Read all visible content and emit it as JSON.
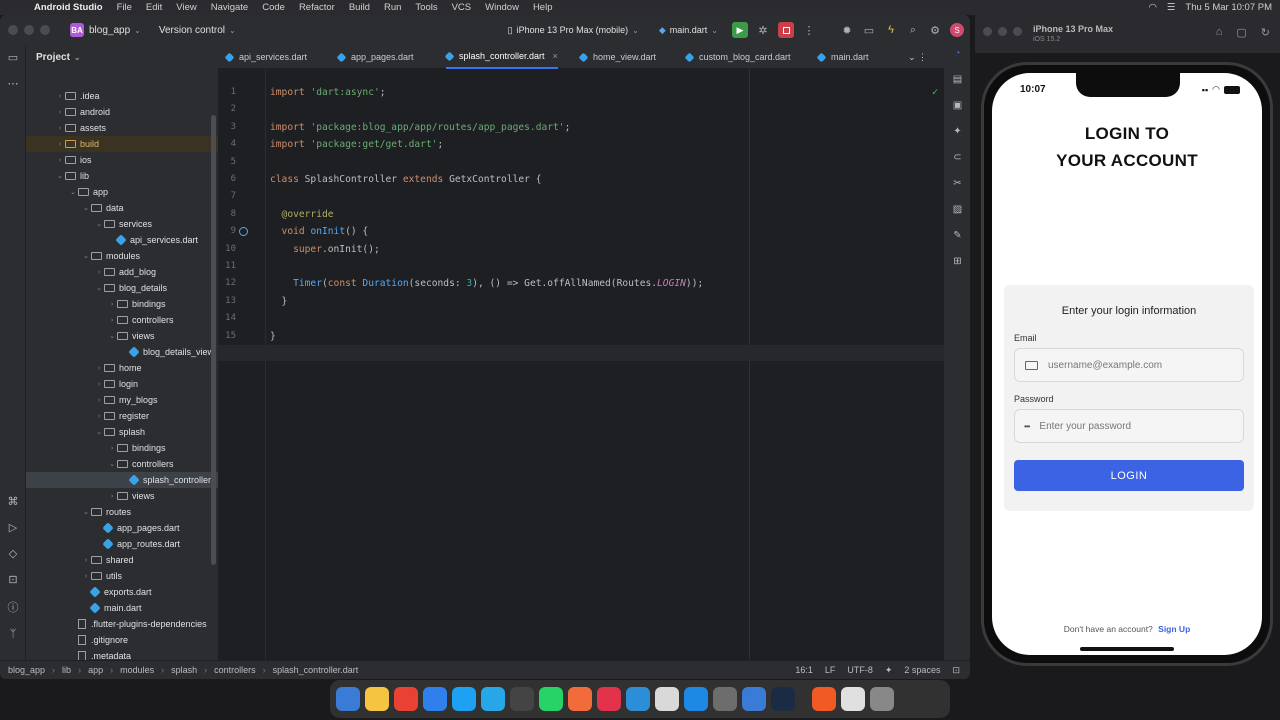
{
  "menubar": {
    "app_name": "Android Studio",
    "items": [
      "File",
      "Edit",
      "View",
      "Navigate",
      "Code",
      "Refactor",
      "Build",
      "Run",
      "Tools",
      "VCS",
      "Window",
      "Help"
    ],
    "datetime": "Thu 5 Mar  10:07 PM"
  },
  "titlebar": {
    "project_badge": "BA",
    "project_name": "blog_app",
    "vcs": "Version control",
    "device": "iPhone 13 Pro Max (mobile)",
    "run_config": "main.dart",
    "user_initial": "S"
  },
  "project_panel": {
    "title": "Project",
    "rows": [
      {
        "label": ".idea",
        "indent": 1,
        "kind": "folder",
        "chev": "›"
      },
      {
        "label": "android",
        "indent": 1,
        "kind": "folder",
        "chev": "›"
      },
      {
        "label": "assets",
        "indent": 1,
        "kind": "folder",
        "chev": "›"
      },
      {
        "label": "build",
        "indent": 1,
        "kind": "folder-orange",
        "chev": "›"
      },
      {
        "label": "ios",
        "indent": 1,
        "kind": "folder",
        "chev": "›"
      },
      {
        "label": "lib",
        "indent": 1,
        "kind": "folder",
        "chev": "⌄"
      },
      {
        "label": "app",
        "indent": 2,
        "kind": "folder",
        "chev": "⌄"
      },
      {
        "label": "data",
        "indent": 3,
        "kind": "folder",
        "chev": "⌄"
      },
      {
        "label": "services",
        "indent": 4,
        "kind": "folder",
        "chev": "⌄"
      },
      {
        "label": "api_services.dart",
        "indent": 5,
        "kind": "dart",
        "chev": ""
      },
      {
        "label": "modules",
        "indent": 3,
        "kind": "folder",
        "chev": "⌄"
      },
      {
        "label": "add_blog",
        "indent": 4,
        "kind": "folder",
        "chev": "›"
      },
      {
        "label": "blog_details",
        "indent": 4,
        "kind": "folder",
        "chev": "⌄"
      },
      {
        "label": "bindings",
        "indent": 5,
        "kind": "folder",
        "chev": "›"
      },
      {
        "label": "controllers",
        "indent": 5,
        "kind": "folder",
        "chev": "›"
      },
      {
        "label": "views",
        "indent": 5,
        "kind": "folder",
        "chev": "⌄"
      },
      {
        "label": "blog_details_view",
        "indent": 6,
        "kind": "dart",
        "chev": ""
      },
      {
        "label": "home",
        "indent": 4,
        "kind": "folder",
        "chev": "›"
      },
      {
        "label": "login",
        "indent": 4,
        "kind": "folder",
        "chev": "›"
      },
      {
        "label": "my_blogs",
        "indent": 4,
        "kind": "folder",
        "chev": "›"
      },
      {
        "label": "register",
        "indent": 4,
        "kind": "folder",
        "chev": "›"
      },
      {
        "label": "splash",
        "indent": 4,
        "kind": "folder",
        "chev": "⌄"
      },
      {
        "label": "bindings",
        "indent": 5,
        "kind": "folder",
        "chev": "›"
      },
      {
        "label": "controllers",
        "indent": 5,
        "kind": "folder",
        "chev": "⌄"
      },
      {
        "label": "splash_controller",
        "indent": 6,
        "kind": "dart",
        "chev": "",
        "selected": true
      },
      {
        "label": "views",
        "indent": 5,
        "kind": "folder",
        "chev": "›"
      },
      {
        "label": "routes",
        "indent": 3,
        "kind": "folder",
        "chev": "⌄"
      },
      {
        "label": "app_pages.dart",
        "indent": 4,
        "kind": "dart",
        "chev": ""
      },
      {
        "label": "app_routes.dart",
        "indent": 4,
        "kind": "dart",
        "chev": ""
      },
      {
        "label": "shared",
        "indent": 3,
        "kind": "folder",
        "chev": "›"
      },
      {
        "label": "utils",
        "indent": 3,
        "kind": "folder",
        "chev": "›"
      },
      {
        "label": "exports.dart",
        "indent": 3,
        "kind": "dart",
        "chev": ""
      },
      {
        "label": "main.dart",
        "indent": 3,
        "kind": "dart",
        "chev": ""
      },
      {
        "label": ".flutter-plugins-dependencies",
        "indent": 2,
        "kind": "plain",
        "chev": ""
      },
      {
        "label": ".gitignore",
        "indent": 2,
        "kind": "plain",
        "chev": ""
      },
      {
        "label": ".metadata",
        "indent": 2,
        "kind": "plain",
        "chev": ""
      }
    ]
  },
  "tabs": [
    {
      "label": "api_services.dart"
    },
    {
      "label": "app_pages.dart"
    },
    {
      "label": "splash_controller.dart",
      "active": true
    },
    {
      "label": "home_view.dart"
    },
    {
      "label": "custom_blog_card.dart"
    },
    {
      "label": "main.dart"
    }
  ],
  "code_lines": [
    [
      [
        "kw",
        "import "
      ],
      [
        "str",
        "'dart:async'"
      ],
      [
        "cls",
        ";"
      ]
    ],
    [],
    [
      [
        "kw",
        "import "
      ],
      [
        "str",
        "'package:blog_app/app/routes/app_pages.dart'"
      ],
      [
        "cls",
        ";"
      ]
    ],
    [
      [
        "kw",
        "import "
      ],
      [
        "str",
        "'package:get/get.dart'"
      ],
      [
        "cls",
        ";"
      ]
    ],
    [],
    [
      [
        "kw",
        "class "
      ],
      [
        "cls",
        "SplashController "
      ],
      [
        "kw",
        "extends "
      ],
      [
        "cls",
        "GetxController {"
      ]
    ],
    [],
    [
      [
        "ann",
        "  @override"
      ]
    ],
    [
      [
        "kw",
        "  void "
      ],
      [
        "fn",
        "onInit"
      ],
      [
        "cls",
        "() {"
      ]
    ],
    [
      [
        "kw",
        "    super"
      ],
      [
        "cls",
        ".onInit();"
      ]
    ],
    [],
    [
      [
        "fn",
        "    Timer"
      ],
      [
        "cls",
        "("
      ],
      [
        "kw",
        "const "
      ],
      [
        "fn",
        "Duration"
      ],
      [
        "cls",
        "(seconds: "
      ],
      [
        "num",
        "3"
      ],
      [
        "cls",
        "), () => Get.offAllNamed(Routes."
      ],
      [
        "it",
        "LOGIN"
      ],
      [
        "cls",
        "));"
      ]
    ],
    [
      [
        "cls",
        "  }"
      ]
    ],
    [],
    [
      [
        "cls",
        "}"
      ]
    ],
    []
  ],
  "statusbar": {
    "crumbs": [
      "blog_app",
      "lib",
      "app",
      "modules",
      "splash",
      "controllers",
      "splash_controller.dart"
    ],
    "position": "16:1",
    "line_sep": "LF",
    "encoding": "UTF-8",
    "indent": "2 spaces"
  },
  "simulator": {
    "device_name": "iPhone 13 Pro Max",
    "ios": "iOS 15.2",
    "time": "10:07",
    "title_line1": "LOGIN TO",
    "title_line2": "YOUR ACCOUNT",
    "card_heading": "Enter your login information",
    "email_label": "Email",
    "email_placeholder": "username@example.com",
    "password_label": "Password",
    "password_placeholder": "Enter your password",
    "login_button": "LOGIN",
    "signup_prompt": "Don't have an account?",
    "signup_link": "Sign Up",
    "accent": "#3b63e3"
  }
}
